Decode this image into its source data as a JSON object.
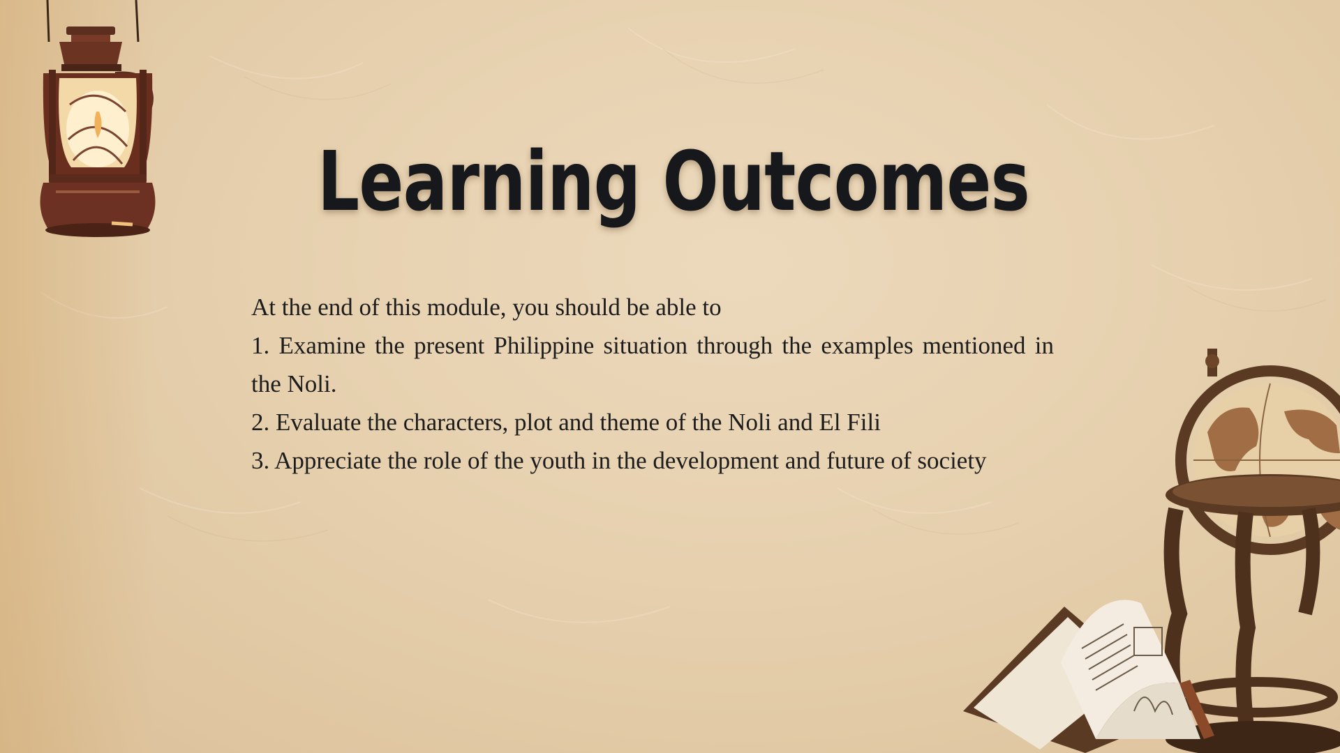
{
  "slide": {
    "title": "Learning Outcomes",
    "intro": "At the end of this module, you should be able to",
    "outcomes": [
      "1. Examine the present Philippine situation through the examples mentioned in the Noli.",
      "2. Evaluate the characters, plot and theme of the Noli and El Fili",
      "3. Appreciate the role of the youth in the development and future of society"
    ]
  },
  "decorations": {
    "top_left": "lantern-icon",
    "bottom_right": "globe-and-books-icon"
  },
  "colors": {
    "background": "#e8d3b3",
    "title": "#16181b",
    "body_text": "#1c1c1c",
    "wood_brown": "#5a3a22",
    "lantern_glow": "#f7e3b8"
  }
}
